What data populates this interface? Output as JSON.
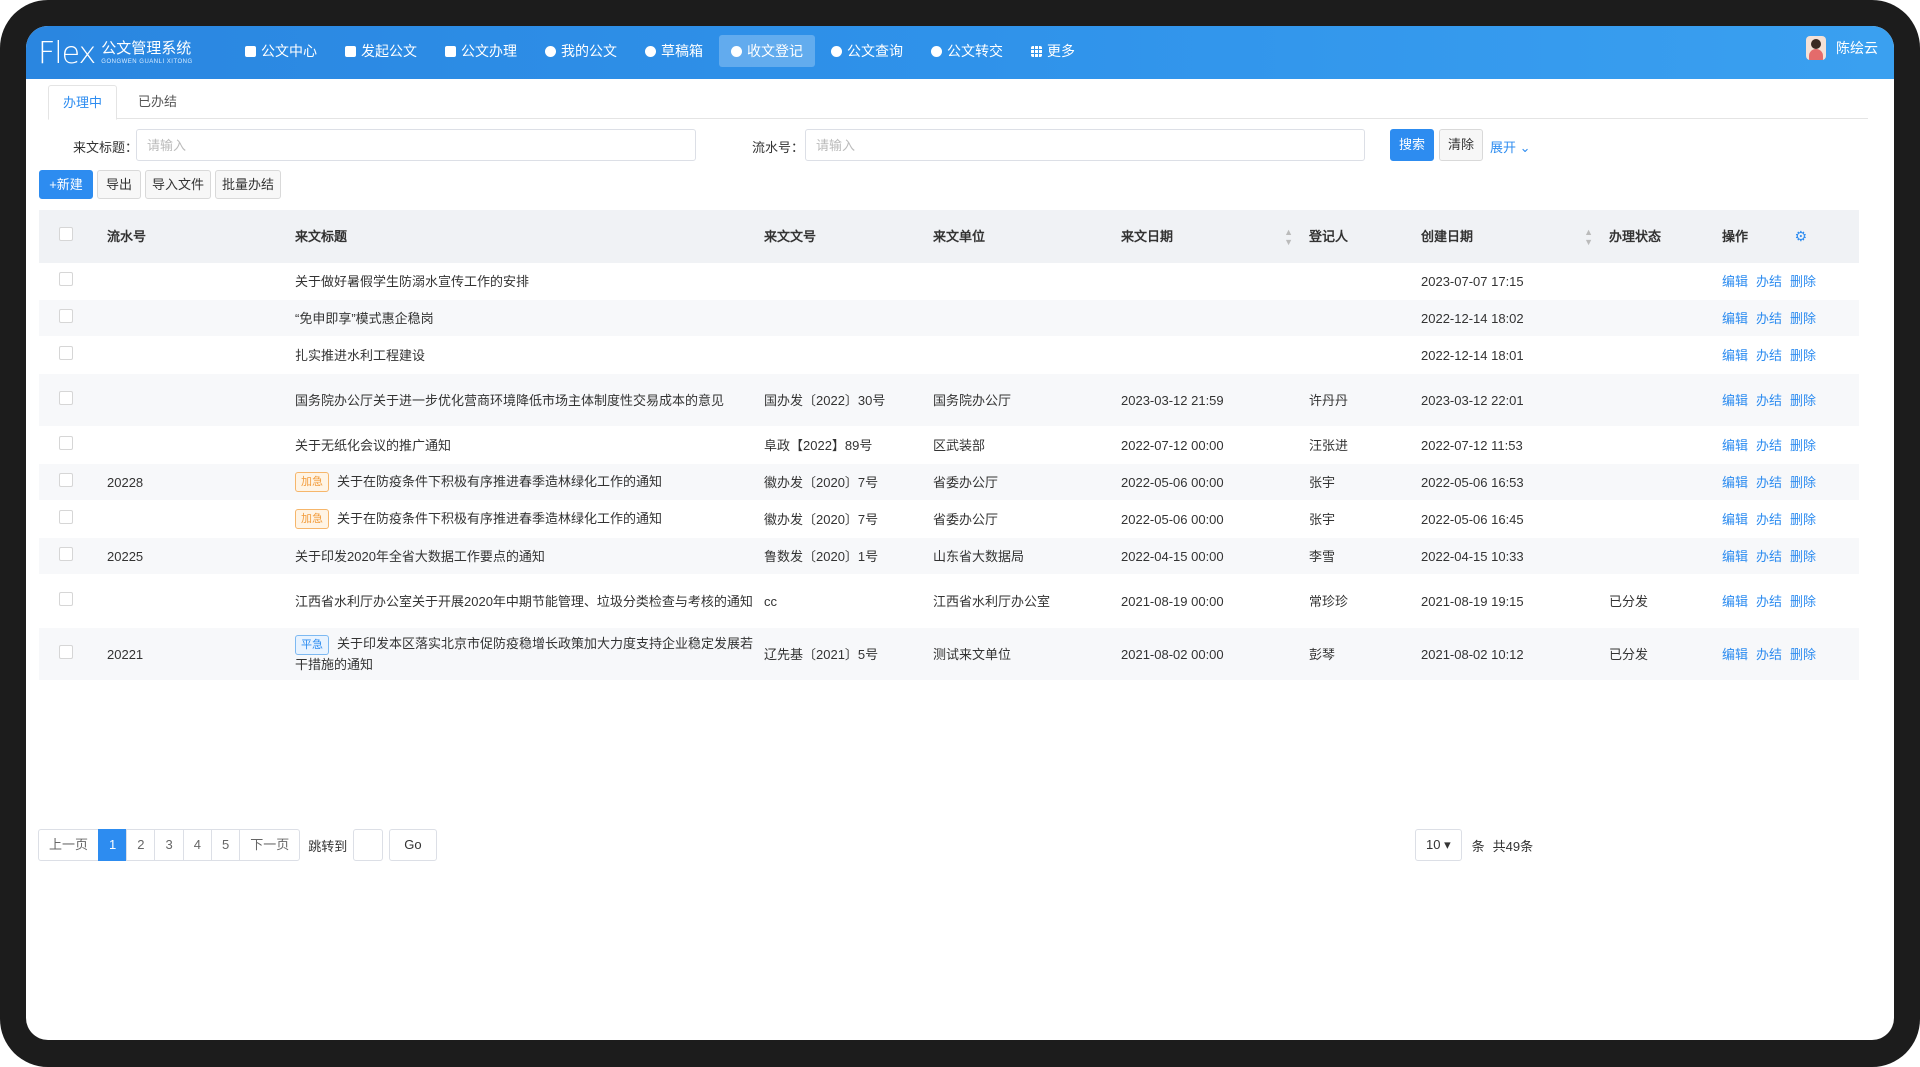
{
  "app": {
    "logo_text": "Flex",
    "name_cn": "公文管理系统",
    "name_en": "GONGWEN GUANLI XITONG"
  },
  "nav": [
    {
      "label": "公文中心",
      "icon": "doc-icon",
      "active": false
    },
    {
      "label": "发起公文",
      "icon": "send-doc-icon",
      "active": false
    },
    {
      "label": "公文办理",
      "icon": "process-icon",
      "active": false
    },
    {
      "label": "我的公文",
      "icon": "my-doc-icon",
      "active": false
    },
    {
      "label": "草稿箱",
      "icon": "draft-icon",
      "active": false
    },
    {
      "label": "收文登记",
      "icon": "register-icon",
      "active": true
    },
    {
      "label": "公文查询",
      "icon": "query-icon",
      "active": false
    },
    {
      "label": "公文转交",
      "icon": "transfer-icon",
      "active": false
    },
    {
      "label": "更多",
      "icon": "grid-icon",
      "active": false
    }
  ],
  "user": {
    "name": "陈绘云"
  },
  "tabs": [
    {
      "label": "办理中",
      "active": true
    },
    {
      "label": "已办结",
      "active": false
    }
  ],
  "filters": {
    "title_label": "来文标题：",
    "title_placeholder": "请输入",
    "serial_label": "流水号：",
    "serial_placeholder": "请输入",
    "search_label": "搜索",
    "clear_label": "清除",
    "expand_label": "展开"
  },
  "toolbar": {
    "new_label": "+新建",
    "export_label": "导出",
    "import_label": "导入文件",
    "batch_label": "批量办结"
  },
  "table": {
    "columns": {
      "serial": "流水号",
      "title": "来文标题",
      "doc_no": "来文文号",
      "unit": "来文单位",
      "date": "来文日期",
      "registrar": "登记人",
      "created": "创建日期",
      "status": "办理状态",
      "ops": "操作"
    },
    "ops": {
      "edit": "编辑",
      "finish": "办结",
      "delete": "删除"
    },
    "rows": [
      {
        "serial": "",
        "tag": "",
        "title": "关于做好暑假学生防溺水宣传工作的安排",
        "doc_no": "",
        "unit": "",
        "date": "",
        "registrar": "",
        "created": "2023-07-07 17:15",
        "status": ""
      },
      {
        "serial": "",
        "tag": "",
        "title": "“免申即享”模式惠企稳岗",
        "doc_no": "",
        "unit": "",
        "date": "",
        "registrar": "",
        "created": "2022-12-14 18:02",
        "status": ""
      },
      {
        "serial": "",
        "tag": "",
        "title": "扎实推进水利工程建设",
        "doc_no": "",
        "unit": "",
        "date": "",
        "registrar": "",
        "created": "2022-12-14 18:01",
        "status": ""
      },
      {
        "serial": "",
        "tag": "",
        "title": "国务院办公厅关于进一步优化营商环境降低市场主体制度性交易成本的意见",
        "doc_no": "国办发〔2022〕30号",
        "unit": "国务院办公厅",
        "date": "2023-03-12 21:59",
        "registrar": "许丹丹",
        "created": "2023-03-12 22:01",
        "status": ""
      },
      {
        "serial": "",
        "tag": "",
        "title": "关于无纸化会议的推广通知",
        "doc_no": "阜政【2022】89号",
        "unit": "区武装部",
        "date": "2022-07-12 00:00",
        "registrar": "汪张进",
        "created": "2022-07-12 11:53",
        "status": ""
      },
      {
        "serial": "20228",
        "tag": "加急",
        "title": "关于在防疫条件下积极有序推进春季造林绿化工作的通知",
        "doc_no": "徽办发〔2020〕7号",
        "unit": "省委办公厅",
        "date": "2022-05-06 00:00",
        "registrar": "张宇",
        "created": "2022-05-06 16:53",
        "status": ""
      },
      {
        "serial": "",
        "tag": "加急",
        "title": "关于在防疫条件下积极有序推进春季造林绿化工作的通知",
        "doc_no": "徽办发〔2020〕7号",
        "unit": "省委办公厅",
        "date": "2022-05-06 00:00",
        "registrar": "张宇",
        "created": "2022-05-06 16:45",
        "status": ""
      },
      {
        "serial": "20225",
        "tag": "",
        "title": "关于印发2020年全省大数据工作要点的通知",
        "doc_no": "鲁数发〔2020〕1号",
        "unit": "山东省大数据局",
        "date": "2022-04-15 00:00",
        "registrar": "李雪",
        "created": "2022-04-15 10:33",
        "status": ""
      },
      {
        "serial": "",
        "tag": "",
        "title": "江西省水利厅办公室关于开展2020年中期节能管理、垃圾分类检查与考核的通知",
        "doc_no": "cc",
        "unit": "江西省水利厅办公室",
        "date": "2021-08-19 00:00",
        "registrar": "常珍珍",
        "created": "2021-08-19 19:15",
        "status": "已分发"
      },
      {
        "serial": "20221",
        "tag": "平急",
        "title": "关于印发本区落实北京市促防疫稳增长政策加大力度支持企业稳定发展若干措施的通知",
        "doc_no": "辽先基〔2021〕5号",
        "unit": "测试来文单位",
        "date": "2021-08-02 00:00",
        "registrar": "彭琴",
        "created": "2021-08-02 10:12",
        "status": "已分发"
      }
    ]
  },
  "pagination": {
    "prev": "上一页",
    "pages": [
      "1",
      "2",
      "3",
      "4",
      "5"
    ],
    "current": "1",
    "next": "下一页",
    "jump_label": "跳转到",
    "go_label": "Go",
    "page_size": "10",
    "unit": "条",
    "total": "共49条"
  },
  "colors": {
    "primary": "#2d8cf0",
    "urgent": "#f29c3c",
    "header_bg": "#2f8ee8"
  }
}
